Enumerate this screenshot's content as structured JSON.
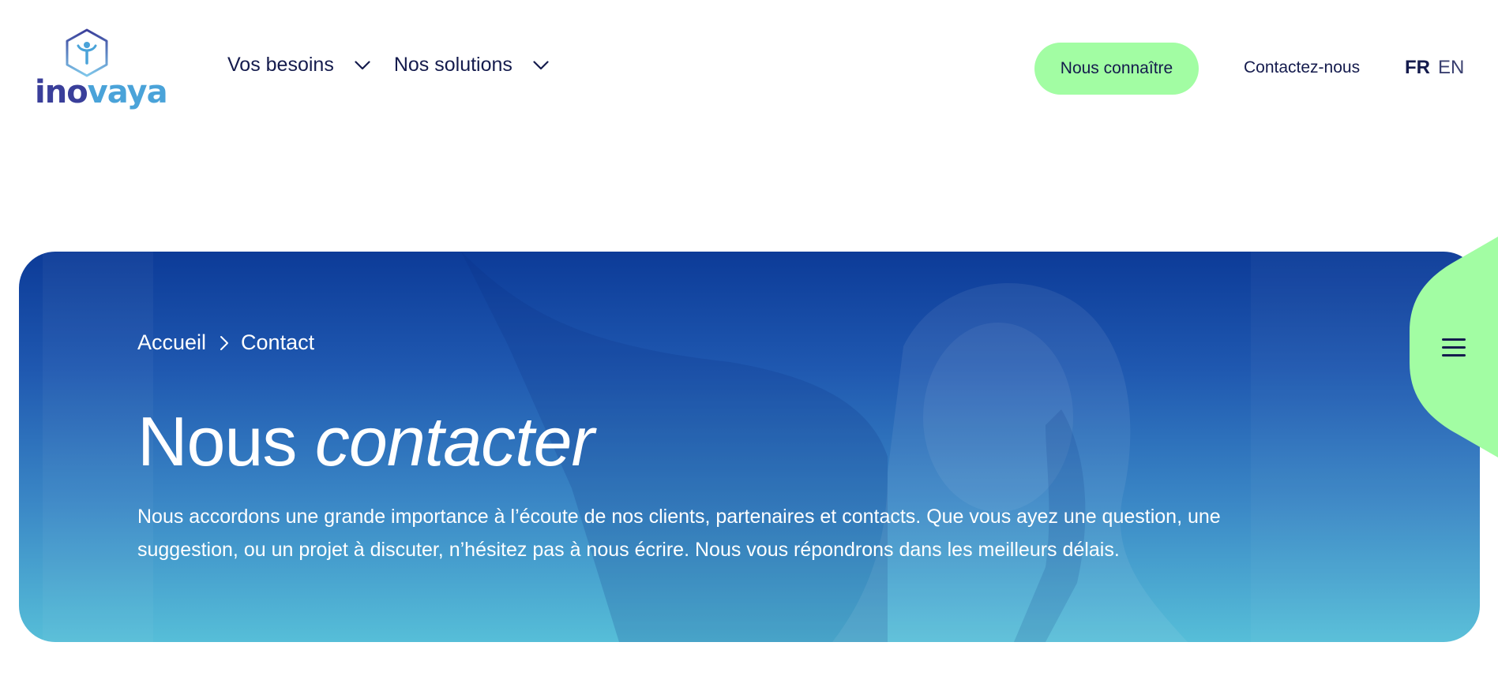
{
  "brand": {
    "logo_part1": "ino",
    "logo_part2": "vaya",
    "logo_icon": "hexagon-person-icon"
  },
  "nav": {
    "items": [
      {
        "label": "Vos besoins",
        "icon": "chevron-down-icon"
      },
      {
        "label": "Nos solutions",
        "icon": "chevron-down-icon"
      }
    ],
    "cta_label": "Nous connaître",
    "contact_label": "Contactez-nous",
    "lang": {
      "fr": "FR",
      "en": "EN",
      "active": "FR"
    }
  },
  "hero": {
    "breadcrumb": [
      {
        "label": "Accueil"
      },
      {
        "label": "Contact"
      }
    ],
    "title_plain": "Nous ",
    "title_italic": "contacter",
    "description": "Nous accordons une grande importance à l’écoute de nos clients, partenaires et contacts. Que vous ayez une question, une suggestion, ou un projet à discuter, n’hésitez pas à nous écrire. Nous vous répondrons dans les meilleurs délais."
  },
  "menu_tab": {
    "icon": "hamburger-menu-icon"
  },
  "colors": {
    "primary_text": "#141b4d",
    "accent_green": "#a2fda3",
    "hero_top": "#0c3b98",
    "hero_bottom": "#56bed8"
  }
}
